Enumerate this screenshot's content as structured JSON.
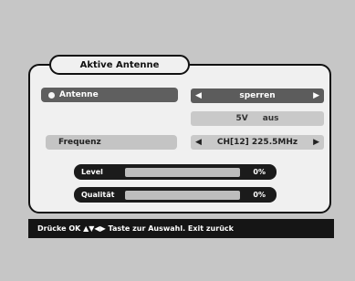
{
  "title": "Aktive Antenne",
  "antenna": {
    "label": "Antenne",
    "value": "sperren"
  },
  "voltage": {
    "value": "5V",
    "state": "aus"
  },
  "frequency": {
    "label": "Frequenz",
    "value": "CH[12] 225.5MHz"
  },
  "meters": [
    {
      "label": "Level",
      "percent_text": "0%",
      "fill_percent": 0
    },
    {
      "label": "Qualität",
      "percent_text": "0%",
      "fill_percent": 0
    }
  ],
  "footer": {
    "text": "Drücke OK ▲▼◀▶ Taste zur Auswahl. Exit zurück"
  },
  "colors": {
    "background": "#c6c6c6",
    "panel": "#f0f0f0",
    "highlight": "#5c5c5c",
    "meter_bg": "#1b1b1b",
    "meter_fill": "#5cc25c"
  }
}
